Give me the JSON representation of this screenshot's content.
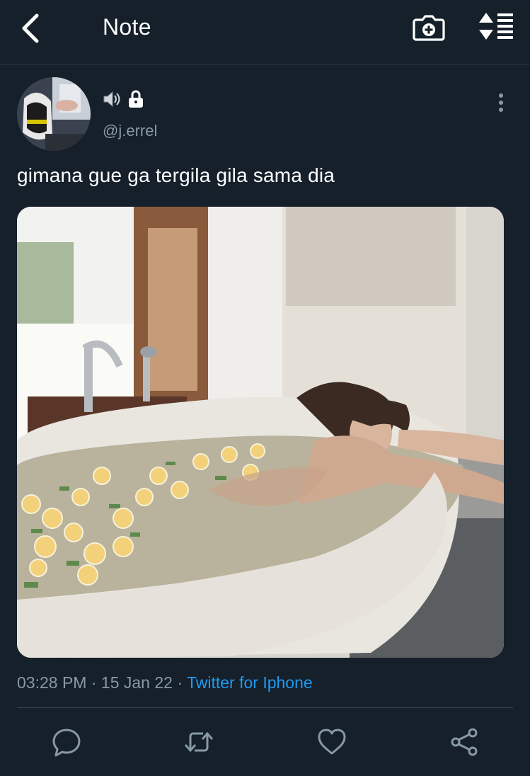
{
  "header": {
    "title": "Note",
    "back_icon": "chevron-left-icon",
    "camera_icon": "camera-plus-icon",
    "sort_icon": "sort-list-icon"
  },
  "tweet": {
    "author_handle": "@j.errel",
    "badges": [
      "speaker-icon",
      "lock-icon"
    ],
    "text": "gimana gue ga tergila gila sama dia",
    "time": "03:28 PM",
    "date": "15 Jan 22",
    "separator": "·",
    "source": "Twitter for Iphone"
  },
  "actions": [
    "reply-icon",
    "retweet-icon",
    "like-icon",
    "share-icon"
  ],
  "colors": {
    "background": "#15202b",
    "muted": "#8899a6",
    "accent": "#1d9bf0",
    "divider": "#38444d"
  }
}
